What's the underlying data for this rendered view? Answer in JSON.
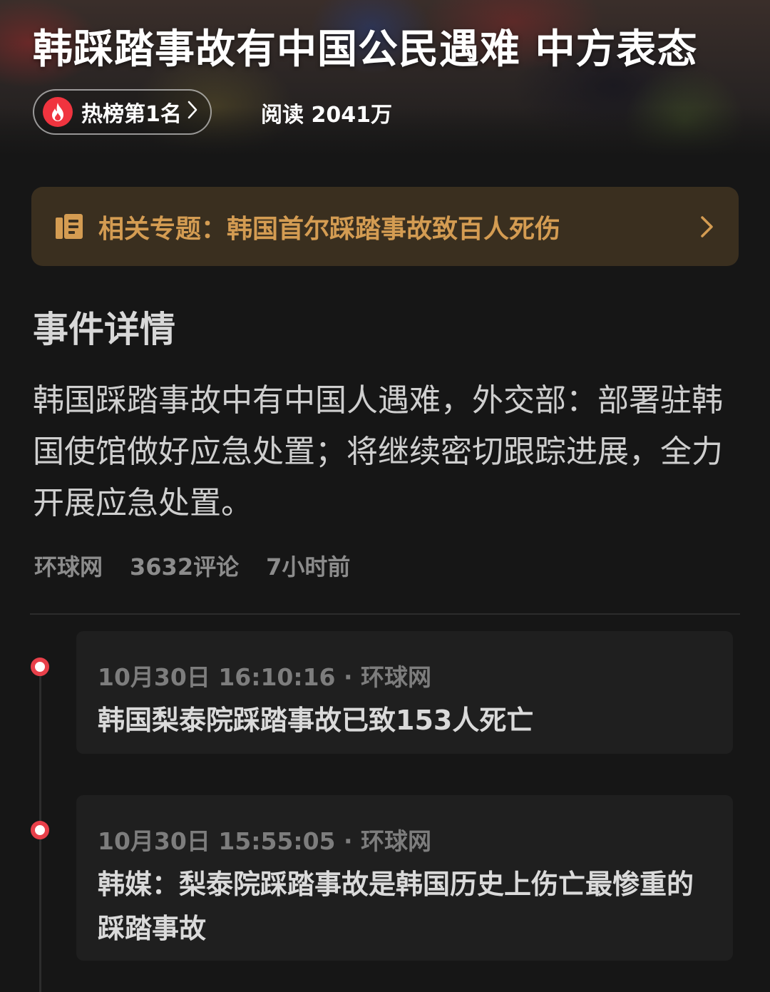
{
  "header": {
    "title": "韩踩踏事故有中国公民遇难 中方表态",
    "rank_label": "热榜第1名",
    "read_count": "阅读 2041万"
  },
  "topic": {
    "label": "相关专题：韩国首尔踩踏事故致百人死伤"
  },
  "details": {
    "heading": "事件详情",
    "summary": "韩国踩踏事故中有中国人遇难，外交部：部署驻韩国使馆做好应急处置；将继续密切跟踪进展，全力开展应急处置。",
    "source": "环球网",
    "comments": "3632评论",
    "time_ago": "7小时前"
  },
  "timeline": [
    {
      "meta": "10月30日 16:10:16 · 环球网",
      "title": "韩国梨泰院踩踏事故已致153人死亡"
    },
    {
      "meta": "10月30日 15:55:05 · 环球网",
      "title": "韩媒：梨泰院踩踏事故是韩国历史上伤亡最惨重的踩踏事故"
    }
  ],
  "colors": {
    "background": "#161616",
    "accent_red": "#f0343f",
    "topic_text": "#d49c52",
    "topic_bg": "#3a2f1f"
  },
  "icons": [
    "fire-icon",
    "chevron-right-icon",
    "document-icon",
    "timeline-dot-icon"
  ]
}
